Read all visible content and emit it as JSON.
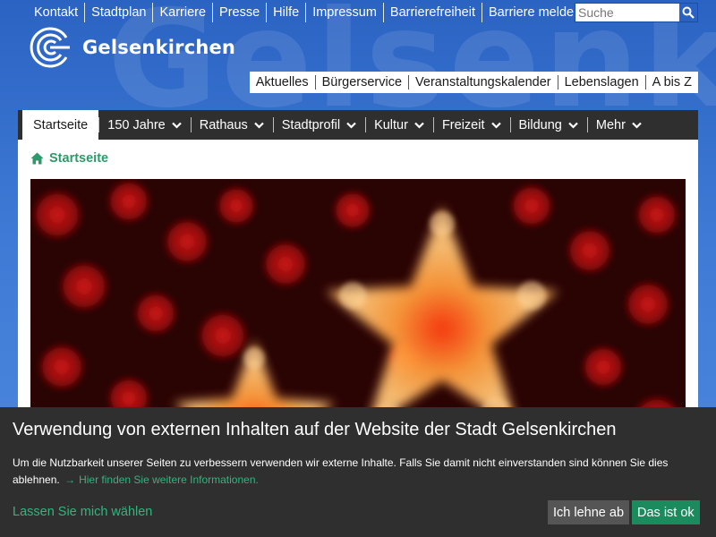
{
  "top_links": [
    "Kontakt",
    "Stadtplan",
    "Karriere",
    "Presse",
    "Hilfe",
    "Impressum",
    "Barrierefreiheit",
    "Barriere melden"
  ],
  "search": {
    "placeholder": "Suche"
  },
  "logo": {
    "text": "Gelsenkirchen"
  },
  "service_links": [
    "Aktuelles",
    "Bürgerservice",
    "Veranstaltungskalender",
    "Lebenslagen",
    "A bis Z"
  ],
  "main_nav": [
    {
      "label": "Startseite",
      "active": true,
      "dropdown": false
    },
    {
      "label": "150 Jahre",
      "active": false,
      "dropdown": true
    },
    {
      "label": "Rathaus",
      "active": false,
      "dropdown": true
    },
    {
      "label": "Stadtprofil",
      "active": false,
      "dropdown": true
    },
    {
      "label": "Kultur",
      "active": false,
      "dropdown": true
    },
    {
      "label": "Freizeit",
      "active": false,
      "dropdown": true
    },
    {
      "label": "Bildung",
      "active": false,
      "dropdown": true
    },
    {
      "label": "Mehr",
      "active": false,
      "dropdown": true
    }
  ],
  "breadcrumb": {
    "label": "Startseite",
    "icon": "home-icon"
  },
  "cookie": {
    "title": "Verwendung von externen Inhalten auf der Website der Stadt Gelsenkirchen",
    "text": "Um die Nutzbarkeit unserer Seiten zu verbessern verwenden wir externe Inhalte. Falls Sie damit nicht einverstanden sind können Sie dies ablehnen.",
    "more_link": "Hier finden Sie weitere Informationen.",
    "choose_link": "Lassen Sie mich wählen",
    "decline_label": "Ich lehne ab",
    "accept_label": "Das ist ok"
  },
  "colors": {
    "header_blue": "#3f7bd6",
    "nav_dark": "#2f2f2f",
    "accent_green": "#2e9a6c",
    "accept_green": "#1b8a5d",
    "decline_gray": "#555555"
  }
}
